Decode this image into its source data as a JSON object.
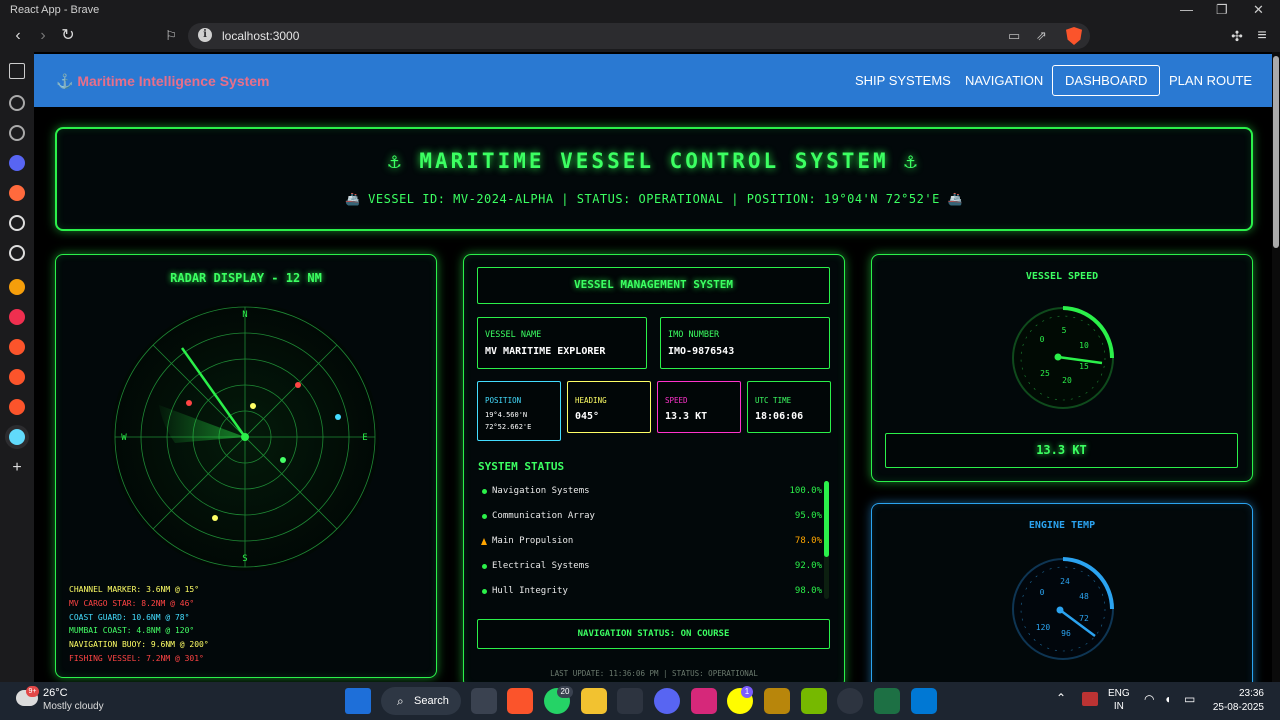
{
  "browser": {
    "window_title": "React App - Brave",
    "url": "localhost:3000"
  },
  "app": {
    "brand": "⚓ Maritime Intelligence System",
    "nav_links": [
      "SHIP SYSTEMS",
      "NAVIGATION",
      "DASHBOARD",
      "PLAN ROUTE"
    ],
    "active_nav": "DASHBOARD"
  },
  "hero": {
    "title": "⚓ MARITIME VESSEL CONTROL SYSTEM ⚓",
    "subtitle": "🚢 VESSEL ID: MV-2024-ALPHA | STATUS: OPERATIONAL | POSITION: 19°04'N 72°52'E 🚢"
  },
  "radar": {
    "title": "RADAR DISPLAY - 12 NM",
    "compass": {
      "n": "N",
      "e": "E",
      "s": "S",
      "w": "W"
    },
    "contacts": [
      {
        "text": "CHANNEL MARKER: 3.6NM @ 15°",
        "color": "#ffff66"
      },
      {
        "text": "MV CARGO STAR: 8.2NM @ 46°",
        "color": "#ff4444"
      },
      {
        "text": "COAST GUARD: 10.6NM @ 78°",
        "color": "#44ddff"
      },
      {
        "text": "MUMBAI COAST: 4.8NM @ 120°",
        "color": "#44ff66"
      },
      {
        "text": "NAVIGATION BUOY: 9.6NM @ 200°",
        "color": "#ffff66"
      },
      {
        "text": "FISHING VESSEL: 7.2NM @ 301°",
        "color": "#ff4444"
      }
    ]
  },
  "vessel": {
    "header": "VESSEL MANAGEMENT SYSTEM",
    "name_label": "VESSEL NAME",
    "name": "MV MARITIME EXPLORER",
    "imo_label": "IMO NUMBER",
    "imo": "IMO-9876543",
    "position_label": "POSITION",
    "position_lat": "19°4.560'N",
    "position_lon": "72°52.662'E",
    "heading_label": "HEADING",
    "heading": "045°",
    "speed_label": "SPEED",
    "speed": "13.3 KT",
    "utc_label": "UTC TIME",
    "utc": "18:06:06",
    "status_title": "SYSTEM STATUS",
    "systems": [
      {
        "name": "Navigation Systems",
        "value": "100.0%",
        "state": "ok",
        "color": "#2bf04a"
      },
      {
        "name": "Communication Array",
        "value": "95.0%",
        "state": "ok",
        "color": "#2bf04a"
      },
      {
        "name": "Main Propulsion",
        "value": "78.0%",
        "state": "warning",
        "color": "#ffa500"
      },
      {
        "name": "Electrical Systems",
        "value": "92.0%",
        "state": "ok",
        "color": "#2bf04a"
      },
      {
        "name": "Hull Integrity",
        "value": "98.0%",
        "state": "ok",
        "color": "#2bf04a"
      }
    ],
    "nav_status": "NAVIGATION STATUS: ON COURSE",
    "last_update": "LAST UPDATE: 11:36:06 PM | STATUS: OPERATIONAL"
  },
  "speed_gauge": {
    "title": "VESSEL SPEED",
    "ticks": [
      "0",
      "5",
      "10",
      "15",
      "20",
      "25"
    ],
    "value": 13.3,
    "readout": "13.3 KT"
  },
  "engine_gauge": {
    "title": "ENGINE TEMP",
    "ticks": [
      "0",
      "24",
      "48",
      "72",
      "96",
      "120"
    ]
  },
  "taskbar": {
    "temperature": "26°C",
    "weather": "Mostly cloudy",
    "weather_badge": "9+",
    "search": "Search",
    "whatsapp_badge": "20",
    "snapchat_badge": "1",
    "lang_top": "ENG",
    "lang_bottom": "IN",
    "time": "23:36",
    "date": "25-08-2025"
  },
  "colors": {
    "neon_green": "#2bf04a",
    "neon_blue": "#2ba3f0",
    "nav_blue": "#2a79d2",
    "brand_pink": "#e86f8a",
    "warning": "#ffa500"
  }
}
